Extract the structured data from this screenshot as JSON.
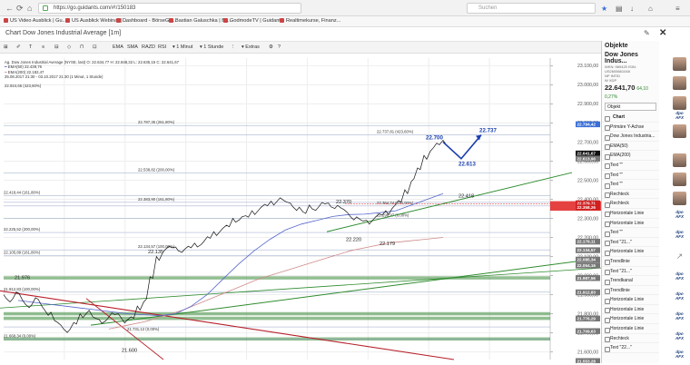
{
  "browser": {
    "url": "https://go.guidants.com/#!/150183",
    "search_placeholder": "Suchen"
  },
  "bookmarks": [
    "US Video Ausblick | Gu...",
    "US Ausblick Webinar | ...",
    "Dashboard - BörseGo ...",
    "Bastian Galuschka | Bö...",
    "GodmodeTV | Guidants",
    "Realtimekurse, Finanz..."
  ],
  "window": {
    "title": "Chart Dow Jones Industrial Average [1m]"
  },
  "toolbar": {
    "buttons": [
      "EMA",
      "SMA",
      "RAZD",
      "RSI",
      "1 Minut",
      "1 Stunde",
      "Extras"
    ]
  },
  "legend": {
    "line1": "Ag. Dow Jones Industrial Average (NYSE, last) O: 22.634,77 H: 22.848,32 L: 22.635,15 C: 22.641,67",
    "line2": "EMA(50) 22.439,76",
    "line3": "EMA(200) 22.182,47",
    "line4": "25.08.2017 21:30 - 03.10.2017 21:30 (1 Minut, 1 Stunde)",
    "line5": "22.924,65 (423,60%)"
  },
  "chart_data": {
    "type": "line",
    "yaxis_ticks": [
      "23.100,00",
      "23.000,00",
      "22.900,00",
      "22.800,00",
      "22.700,00",
      "22.600,00",
      "22.500,00",
      "22.400,00",
      "22.300,00",
      "22.200,00",
      "22.100,00",
      "22.000,00",
      "21.900,00",
      "21.800,00",
      "21.700,00",
      "21.600,00"
    ],
    "ylim": [
      21560,
      23140
    ],
    "price_series": [
      21890,
      21870,
      21910,
      21860,
      21840,
      21880,
      21830,
      21800,
      21760,
      21730,
      21710,
      21750,
      21790,
      21810,
      21780,
      21760,
      21770,
      21800,
      21790,
      21760,
      21780,
      21830,
      21870,
      21990,
      22090,
      22130,
      22150,
      22140,
      22130,
      22150,
      22160,
      22170,
      22200,
      22220,
      22240,
      22260,
      22290,
      22300,
      22310,
      22330,
      22350,
      22370,
      22380,
      22400,
      22390,
      22370,
      22350,
      22330,
      22360,
      22350,
      22380,
      22370,
      22360,
      22350,
      22320,
      22300,
      22290,
      22280,
      22300,
      22320,
      22330,
      22360,
      22390,
      22440,
      22500,
      22560,
      22620,
      22660,
      22690,
      22700
    ],
    "ema50": [
      21870,
      21860,
      21850,
      21840,
      21830,
      21820,
      21810,
      21800,
      21795,
      21790,
      21800,
      21840,
      21900,
      21980,
      22060,
      22130,
      22190,
      22240,
      22270,
      22290,
      22310,
      22320,
      22322,
      22330,
      22340,
      22370,
      22400,
      22430
    ],
    "ema200": [
      21720,
      21740,
      21760,
      21790,
      21820,
      21860,
      21900,
      21940,
      21980,
      22010,
      22040,
      22070,
      22100,
      22130,
      22150,
      22170,
      22180,
      22190,
      22200
    ],
    "projection": [
      {
        "x": 0,
        "y": 22700
      },
      {
        "x": 1,
        "y": 22613
      },
      {
        "x": 2,
        "y": 22737
      }
    ],
    "fib_levels": [
      {
        "label": "22.787,35 (261,80%)",
        "value": 22787
      },
      {
        "label": "22.737,81 (423,60%)",
        "value": 22738
      },
      {
        "label": "22.538,82 (200,00%)",
        "value": 22539
      },
      {
        "label": "22.418,44 (161,80%)",
        "value": 22418
      },
      {
        "label": "22.383,90 (161,80%)",
        "value": 22384
      },
      {
        "label": "22.364,74 (100,00%)",
        "value": 22365
      },
      {
        "label": "22.298,97 (0,00%)",
        "value": 22299
      },
      {
        "label": "22.225,52 (200,00%)",
        "value": 22226
      },
      {
        "label": "22.134,57 (100,00%)",
        "value": 22135
      },
      {
        "label": "22.105,89 (161,80%)",
        "value": 22106
      },
      {
        "label": "21.912,83 (100,00%)",
        "value": 21913
      },
      {
        "label": "21.731,12 (0,00%)",
        "value": 21731
      },
      {
        "label": "21.668,34 (0,00%)",
        "value": 21668
      }
    ],
    "annotations": [
      {
        "text": "22.700",
        "value": 22700
      },
      {
        "text": "22.737",
        "value": 22737
      },
      {
        "text": "22.613",
        "value": 22613
      },
      {
        "text": "22.418",
        "value": 22418
      },
      {
        "text": "22.370",
        "value": 22370
      },
      {
        "text": "22.220",
        "value": 22220
      },
      {
        "text": "22.179",
        "value": 22179
      },
      {
        "text": "22.135",
        "value": 22135
      },
      {
        "text": "21.976",
        "value": 21976
      },
      {
        "text": "21.600",
        "value": 21600
      }
    ],
    "price_labels": [
      {
        "text": "22.794,42",
        "value": 22794,
        "kind": "blue"
      },
      {
        "text": "22.641,67",
        "value": 22641,
        "kind": "black"
      },
      {
        "text": "22.613,96",
        "value": 22614,
        "kind": "gray"
      },
      {
        "text": "22.379,71",
        "value": 22380,
        "kind": "red"
      },
      {
        "text": "22.358,26",
        "value": 22358,
        "kind": "red"
      },
      {
        "text": "22.179,11",
        "value": 22179,
        "kind": "gray"
      },
      {
        "text": "22.134,57",
        "value": 22134,
        "kind": "gray"
      },
      {
        "text": "22.085,34",
        "value": 22085,
        "kind": "gray"
      },
      {
        "text": "22.054,16",
        "value": 22054,
        "kind": "gray"
      },
      {
        "text": "21.987,56",
        "value": 21988,
        "kind": "gray"
      },
      {
        "text": "21.912,83",
        "value": 21913,
        "kind": "gray"
      },
      {
        "text": "21.776,29",
        "value": 21776,
        "kind": "gray"
      },
      {
        "text": "21.709,63",
        "value": 21710,
        "kind": "gray"
      },
      {
        "text": "21.553,28",
        "value": 21553,
        "kind": "gray"
      }
    ],
    "support_bands": [
      21988,
      21800,
      21776,
      21668
    ],
    "colors": {
      "price": "#111111",
      "ema50": "#5566cc",
      "ema200": "#d08a8a",
      "green_trend": "#2e8b2e",
      "red_trend": "#b8202a",
      "projection": "#1a3fb0",
      "band": "#3a8a3a"
    }
  },
  "panel": {
    "header": "Objekte",
    "card_title": "Dow Jones Indus...",
    "card_meta1": "WKN: 969420  ISIN: US2605661048",
    "card_meta2": "NP   INTID",
    "card_meta3": "W   XDP",
    "price": "22.641,70",
    "change": "64,10  0,27%",
    "input_value": "Objekt",
    "items": [
      "Chart",
      "Primäre Y-Achse",
      "Dow Jones Industria...",
      "EMA(50)",
      "EMA(200)",
      "Text \"\"",
      "Text \"\"",
      "Text \"\"",
      "Rechteck",
      "Rechteck",
      "Horizontale Linie",
      "Horizontale Linie",
      "Text \"\"",
      "Text \"21...\"",
      "Horizontale Linie",
      "Trendlinie",
      "Text \"21...\"",
      "Trendkanal",
      "Trendlinie",
      "Horizontale Linie",
      "Horizontale Linie",
      "Horizontale Linie",
      "Horizontale Linie",
      "Rechteck",
      "Text \"22...\""
    ]
  },
  "strip": {
    "dpo_label": "dpo AFX"
  }
}
